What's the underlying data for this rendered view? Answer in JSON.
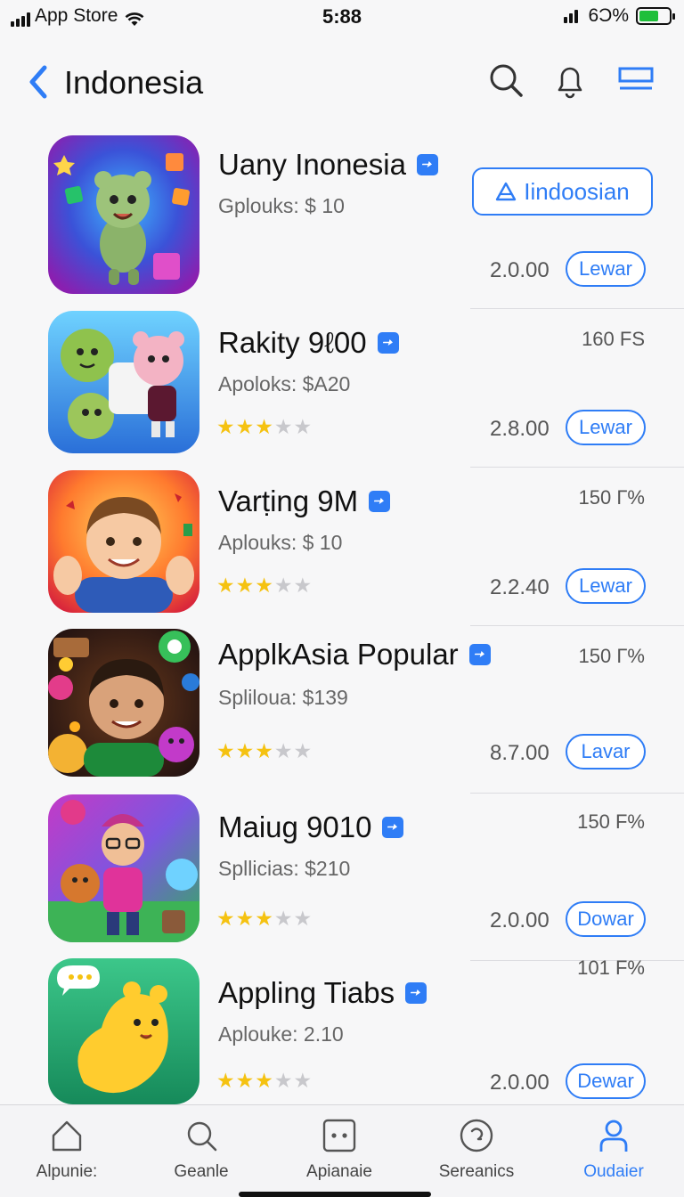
{
  "status_bar": {
    "carrier": "App Store",
    "time": "5:88",
    "battery": "6Ɔ%",
    "battery_level": 0.65
  },
  "nav": {
    "title": "Indonesia",
    "icons": [
      "back-chevron-icon",
      "search-icon",
      "bell-icon",
      "list-view-icon"
    ]
  },
  "apps": [
    {
      "name": "Uany Inonesia",
      "subtitle": "Gplouks: $ 10",
      "size": "",
      "price": "2.0.00",
      "get_label": "Lewar",
      "rating": null,
      "action_label": "Iindoosian"
    },
    {
      "name": "Rakity 9ℓ00",
      "subtitle": "Apoloks: $A20",
      "size": "160 FS",
      "price": "2.8.00",
      "get_label": "Lewar",
      "rating": 3
    },
    {
      "name": "Varṭing 9M",
      "subtitle": "Aplouks: $ 10",
      "size": "150 Γ%",
      "price": "2.2.40",
      "get_label": "Lewar",
      "rating": 3
    },
    {
      "name": "ApplkAsia Popular",
      "subtitle": "Spliloua: $139",
      "size": "150 Γ%",
      "price": "8.7.00",
      "get_label": "Lavar",
      "rating": 3
    },
    {
      "name": "Maiug 9010",
      "subtitle": "Spllicias: $210",
      "size": "150 F%",
      "price": "2.0.00",
      "get_label": "Dowar",
      "rating": 3
    },
    {
      "name": "Appling Tiabs",
      "subtitle": "Aplouke: 2.10",
      "size": "101 F%",
      "price": "2.0.00",
      "get_label": "Dewar",
      "rating": 3
    }
  ],
  "tabs": [
    {
      "label": "Alpunie:",
      "icon": "home-icon",
      "active": false
    },
    {
      "label": "Geanle",
      "icon": "search-icon",
      "active": false
    },
    {
      "label": "Apianaie",
      "icon": "apps-icon",
      "active": false
    },
    {
      "label": "Sereanics",
      "icon": "updates-icon",
      "active": false
    },
    {
      "label": "Oudaier",
      "icon": "profile-icon",
      "active": true
    }
  ],
  "colors": {
    "accent": "#2f7df6",
    "star": "#f5c211"
  }
}
